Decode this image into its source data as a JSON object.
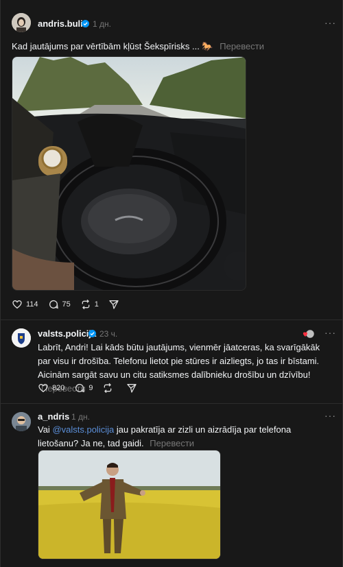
{
  "posts": [
    {
      "username": "andris.bulis",
      "time": "1 дн.",
      "text": "Kad jautājums par vērtībām kļūst Šekspīrisks ... 🐎",
      "translate": "Перевести",
      "likes": "114",
      "comments": "75",
      "reposts": "1"
    },
    {
      "username": "valsts.policija",
      "time": "23 ч.",
      "text": "Labrīt, Andri! Lai kāds būtu jautājums, vienmēr jāatceras, ka svarīgākāk par visu ir drošība. Telefonu lietot pie stūres ir aizliegts, jo tas ir bīstami. Aicinām sargāt savu un citu satiksmes dalībnieku drošību un dzīvību!",
      "translate": "Перевести",
      "likes": "820",
      "comments": "9"
    },
    {
      "username": "a_ndris",
      "time": "1 дн.",
      "text_pre": "Vai ",
      "mention": "@valsts.policija",
      "text_post": " jau pakratīja ar zizli un aizrādīja par telefona lietošanu? Ja ne, tad gaidi.",
      "translate": "Перевести"
    }
  ],
  "more_label": "···",
  "colors": {
    "background": "#181818",
    "verified": "#0095f6",
    "mention": "#5b8fd9",
    "muted": "#777777"
  }
}
